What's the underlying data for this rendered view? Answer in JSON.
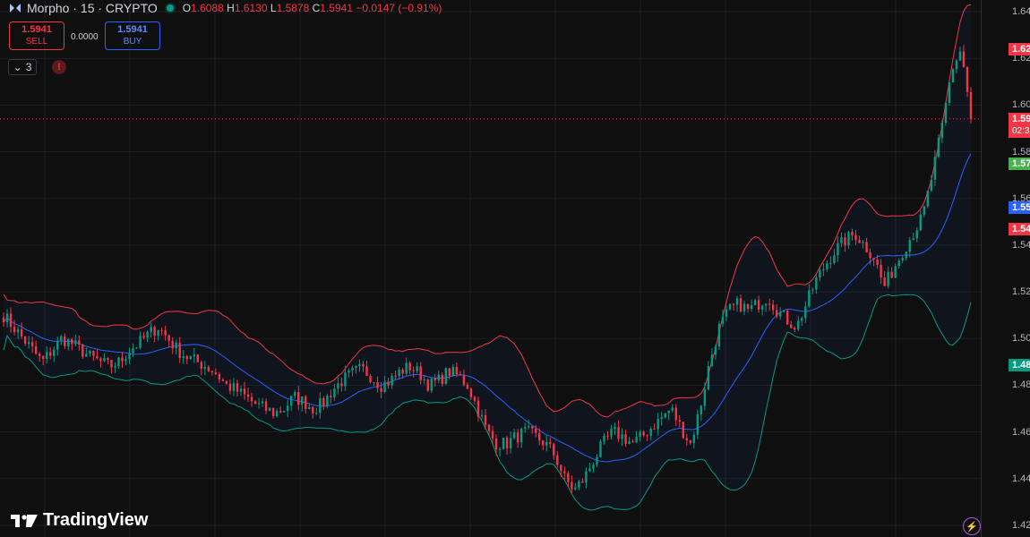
{
  "header": {
    "symbol": "Morpho · 15 · CRYPTO",
    "open_label": "O",
    "open": "1.6088",
    "high_label": "H",
    "high": "1.6130",
    "low_label": "L",
    "low": "1.5878",
    "close_label": "C",
    "close": "1.5941",
    "change": "−0.0147 (−0.91%)"
  },
  "trade": {
    "sell_price": "1.5941",
    "sell_label": "SELL",
    "spread": "0.0000",
    "buy_price": "1.5941",
    "buy_label": "BUY"
  },
  "indicators": {
    "count": "3",
    "alert_glyph": "!"
  },
  "price_axis": {
    "ticks": [
      "1.64",
      "1.62",
      "1.60",
      "1.58",
      "1.56",
      "1.54",
      "1.52",
      "1.50",
      "1.48",
      "1.46",
      "1.44",
      "1.42"
    ],
    "labels": [
      {
        "text": "1.62",
        "value": 1.624,
        "color": "#f23645"
      },
      {
        "text": "1.59",
        "sub": "02:3",
        "value": 1.5941,
        "color": "#f23645"
      },
      {
        "text": "1.57",
        "value": 1.575,
        "color": "#4caf50"
      },
      {
        "text": "1.55",
        "value": 1.556,
        "color": "#2962ff"
      },
      {
        "text": "1.54",
        "value": 1.547,
        "color": "#f23645"
      },
      {
        "text": "1.48",
        "value": 1.4885,
        "color": "#089981"
      }
    ]
  },
  "branding": {
    "logo_text": "TradingView"
  },
  "colors": {
    "background": "#0f0f0f",
    "up": "#089981",
    "down": "#f23645",
    "basis": "#2962ff",
    "upper_band": "#f23645",
    "lower_band": "#089981"
  },
  "chart_data": {
    "type": "candlestick",
    "ylim": [
      1.415,
      1.645
    ],
    "current_price": 1.5941,
    "price_path": [
      1.51,
      1.505,
      1.5,
      1.495,
      1.49,
      1.495,
      1.5,
      1.498,
      1.495,
      1.492,
      1.49,
      1.488,
      1.49,
      1.495,
      1.498,
      1.502,
      1.505,
      1.5,
      1.495,
      1.492,
      1.49,
      1.488,
      1.485,
      1.48,
      1.478,
      1.475,
      1.472,
      1.47,
      1.468,
      1.47,
      1.475,
      1.473,
      1.47,
      1.472,
      1.478,
      1.482,
      1.485,
      1.487,
      1.484,
      1.48,
      1.482,
      1.486,
      1.488,
      1.485,
      1.48,
      1.482,
      1.486,
      1.484,
      1.48,
      1.47,
      1.46,
      1.455,
      1.455,
      1.458,
      1.46,
      1.458,
      1.455,
      1.45,
      1.44,
      1.435,
      1.44,
      1.448,
      1.455,
      1.46,
      1.458,
      1.455,
      1.458,
      1.462,
      1.466,
      1.47,
      1.462,
      1.455,
      1.47,
      1.49,
      1.505,
      1.512,
      1.515,
      1.512,
      1.515,
      1.518,
      1.512,
      1.508,
      1.505,
      1.515,
      1.525,
      1.532,
      1.538,
      1.542,
      1.545,
      1.54,
      1.535,
      1.522,
      1.53,
      1.538,
      1.545,
      1.552,
      1.57,
      1.59,
      1.615,
      1.624,
      1.5941
    ]
  }
}
